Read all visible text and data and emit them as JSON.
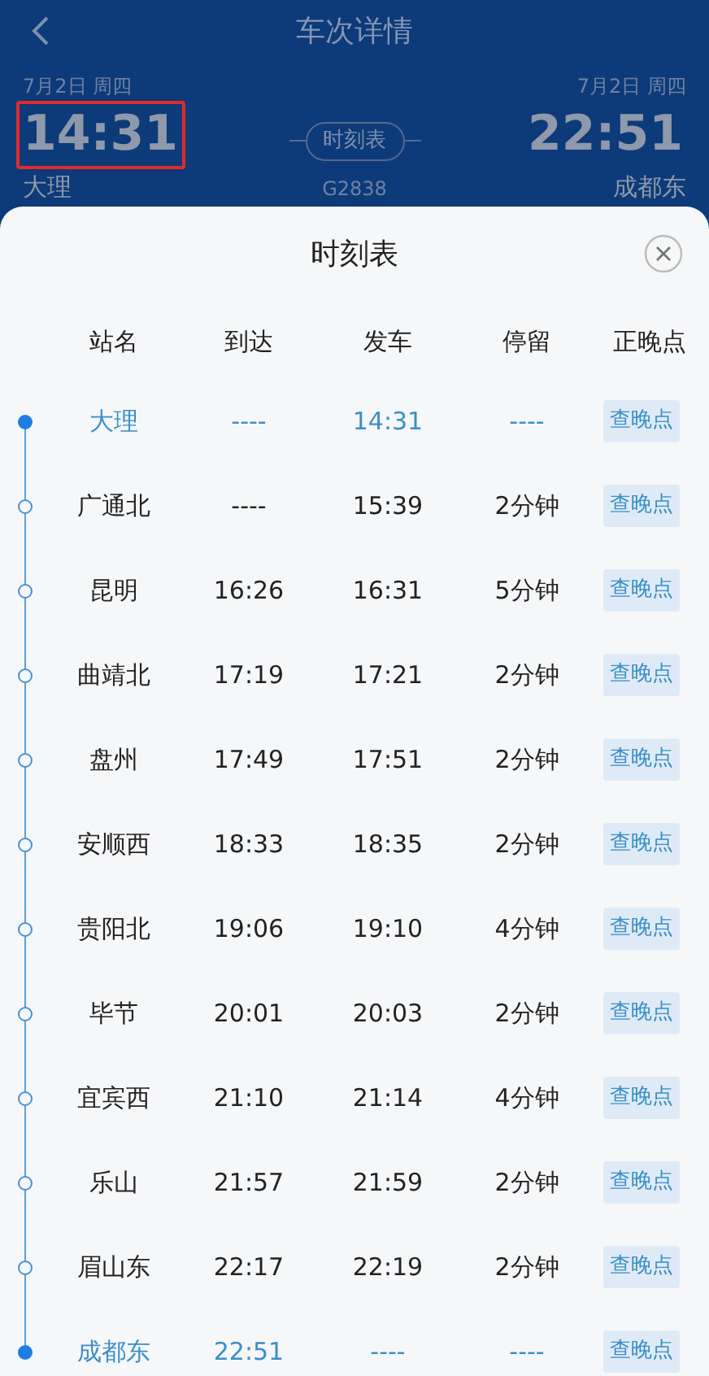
{
  "header": {
    "title": "车次详情",
    "departure": {
      "date": "7月2日 周四",
      "time": "14:31",
      "station": "大理",
      "highlighted": true
    },
    "arrival": {
      "date": "7月2日 周四",
      "time": "22:51",
      "station": "成都东"
    },
    "timetable_button": "时刻表",
    "train_number": "G2838"
  },
  "sheet": {
    "title": "时刻表",
    "columns": [
      "站名",
      "到达",
      "发车",
      "停留",
      "正晚点"
    ],
    "rows": [
      {
        "kind": "terminal",
        "station": "大理",
        "arrive": "----",
        "depart": "14:31",
        "stay": "----",
        "action": "查晚点"
      },
      {
        "kind": "stop",
        "station": "广通北",
        "arrive": "----",
        "depart": "15:39",
        "stay": "2分钟",
        "action": "查晚点"
      },
      {
        "kind": "stop",
        "station": "昆明",
        "arrive": "16:26",
        "depart": "16:31",
        "stay": "5分钟",
        "action": "查晚点"
      },
      {
        "kind": "stop",
        "station": "曲靖北",
        "arrive": "17:19",
        "depart": "17:21",
        "stay": "2分钟",
        "action": "查晚点"
      },
      {
        "kind": "stop",
        "station": "盘州",
        "arrive": "17:49",
        "depart": "17:51",
        "stay": "2分钟",
        "action": "查晚点"
      },
      {
        "kind": "stop",
        "station": "安顺西",
        "arrive": "18:33",
        "depart": "18:35",
        "stay": "2分钟",
        "action": "查晚点"
      },
      {
        "kind": "stop",
        "station": "贵阳北",
        "arrive": "19:06",
        "depart": "19:10",
        "stay": "4分钟",
        "action": "查晚点"
      },
      {
        "kind": "stop",
        "station": "毕节",
        "arrive": "20:01",
        "depart": "20:03",
        "stay": "2分钟",
        "action": "查晚点"
      },
      {
        "kind": "stop",
        "station": "宜宾西",
        "arrive": "21:10",
        "depart": "21:14",
        "stay": "4分钟",
        "action": "查晚点"
      },
      {
        "kind": "stop",
        "station": "乐山",
        "arrive": "21:57",
        "depart": "21:59",
        "stay": "2分钟",
        "action": "查晚点"
      },
      {
        "kind": "stop",
        "station": "眉山东",
        "arrive": "22:17",
        "depart": "22:19",
        "stay": "2分钟",
        "action": "查晚点"
      },
      {
        "kind": "terminal",
        "station": "成都东",
        "arrive": "22:51",
        "depart": "----",
        "stay": "----",
        "action": "查晚点"
      }
    ]
  }
}
